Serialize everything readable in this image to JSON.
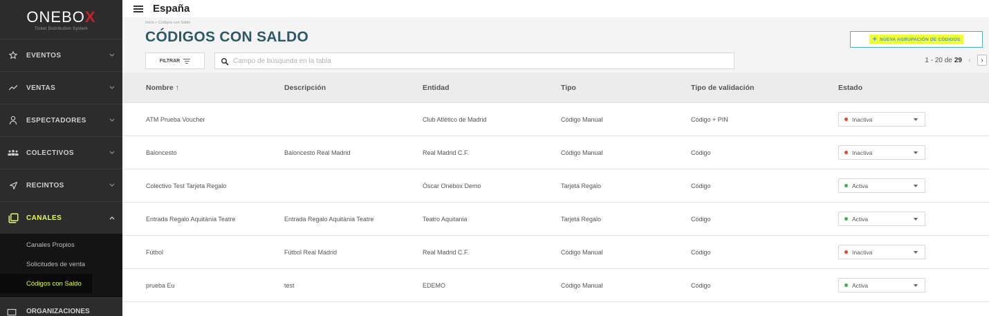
{
  "brand": {
    "logo_main": "ONEBO",
    "logo_x": "X",
    "tagline": "Ticket Distribution System"
  },
  "topbar": {
    "title": "España"
  },
  "sidebar": {
    "items": [
      {
        "label": "EVENTOS",
        "icon": "star-icon"
      },
      {
        "label": "VENTAS",
        "icon": "trend-icon"
      },
      {
        "label": "ESPECTADORES",
        "icon": "person-icon"
      },
      {
        "label": "COLECTIVOS",
        "icon": "group-icon"
      },
      {
        "label": "RECINTOS",
        "icon": "navigation-icon"
      },
      {
        "label": "CANALES",
        "icon": "channels-icon"
      }
    ],
    "subitems": [
      {
        "label": "Canales Propios"
      },
      {
        "label": "Solicitudes de venta"
      },
      {
        "label": "Códigos con Saldo"
      }
    ],
    "bottom_label": "ORGANIZACIONES"
  },
  "main": {
    "breadcrumb": "Inicio > Códigos con Saldo",
    "title": "CÓDIGOS CON SALDO",
    "new_button_label": "NUEVA AGRUPACIÓN DE CÓDIGOS",
    "filter_label": "FILTRAR",
    "search_placeholder": "Campo de búsqueda en la tabla",
    "pagination": {
      "range": "1 - 20 de",
      "total": "29"
    }
  },
  "table": {
    "headers": {
      "nombre": "Nombre ↑",
      "descripcion": "Descripción",
      "entidad": "Entidad",
      "tipo": "Tipo",
      "validacion": "Tipo de validación",
      "estado": "Estado"
    },
    "rows": [
      {
        "nombre": "ATM Prueba Voucher",
        "descripcion": "",
        "entidad": "Club Atlético de Madrid",
        "tipo": "Código Manual",
        "validacion": "Código + PIN",
        "estado": "Inactiva"
      },
      {
        "nombre": "Baloncesto",
        "descripcion": "Baloncesto Real Madrid",
        "entidad": "Real Madrid C.F.",
        "tipo": "Código Manual",
        "validacion": "Código",
        "estado": "Inactiva"
      },
      {
        "nombre": "Colectivo Test Tarjeta Regalo",
        "descripcion": "",
        "entidad": "Óscar Onebox Demo",
        "tipo": "Tarjeta Regalo",
        "validacion": "Código",
        "estado": "Activa"
      },
      {
        "nombre": "Entrada Regalo Aquitània Teatre",
        "descripcion": "Entrada Regalo Aquitània Teatre",
        "entidad": "Teatro Aquitania",
        "tipo": "Tarjeta Regalo",
        "validacion": "Código",
        "estado": "Activa"
      },
      {
        "nombre": "Fútbol",
        "descripcion": "Fútbol Real Madrid",
        "entidad": "Real Madrid C.F.",
        "tipo": "Código Manual",
        "validacion": "Código",
        "estado": "Inactiva"
      },
      {
        "nombre": "prueba Eu",
        "descripcion": "test",
        "entidad": "EDEMO",
        "tipo": "Código Manual",
        "validacion": "Código",
        "estado": "Activa"
      }
    ]
  },
  "colors": {
    "inactive_dot": "#e8452c",
    "active_dot": "#3cb44b",
    "accent_yellow": "#e8ff3a",
    "title_teal": "#2b5a66"
  }
}
